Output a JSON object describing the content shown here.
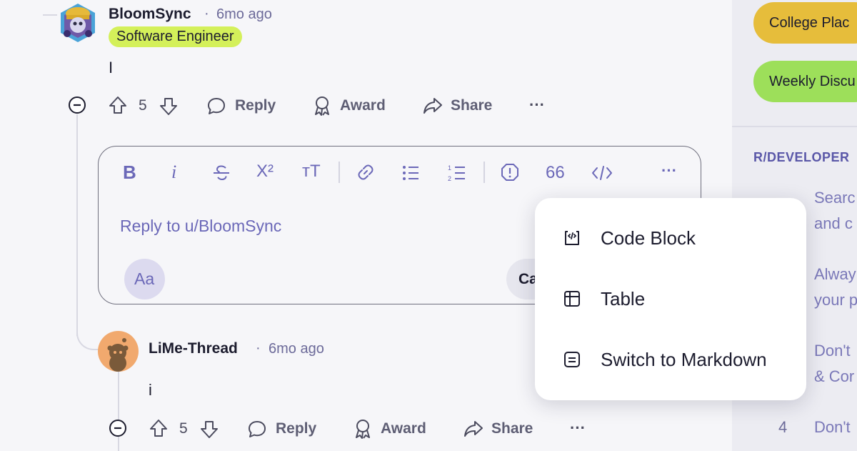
{
  "comment1": {
    "username": "BloomSync",
    "time": "6mo ago",
    "flair": "Software Engineer",
    "body": "I",
    "votes": "5",
    "actions": {
      "reply": "Reply",
      "award": "Award",
      "share": "Share",
      "more": "···"
    }
  },
  "editor": {
    "toolbar": {
      "bold": "B",
      "italic": "i",
      "superscript": "X²",
      "heading": "тT",
      "quote": "66",
      "more": "···"
    },
    "placeholder": "Reply to u/BloomSync",
    "format_button": "Aa",
    "cancel_partial": "Ca"
  },
  "dropdown": {
    "items": [
      {
        "label": "Code Block",
        "icon": "code-block-icon"
      },
      {
        "label": "Table",
        "icon": "table-icon"
      },
      {
        "label": "Switch to Markdown",
        "icon": "markdown-icon"
      }
    ]
  },
  "comment2": {
    "username": "LiMe-Thread",
    "time": "6mo ago",
    "body": "i",
    "votes": "5",
    "actions": {
      "reply": "Reply",
      "award": "Award",
      "share": "Share",
      "more": "···"
    }
  },
  "sidebar": {
    "pills": [
      {
        "label": "College Plac",
        "color": "#e6bd3b"
      },
      {
        "label": "Weekly Discu",
        "color": "#9ddf5a"
      }
    ],
    "section_title": "R/DEVELOPER",
    "rules": [
      {
        "num": "",
        "line1": "Searc",
        "line2": "and c"
      },
      {
        "num": "",
        "line1": "Alway",
        "line2": "your p"
      },
      {
        "num": "",
        "line1": "Don't",
        "line2": "& Cor"
      },
      {
        "num": "4",
        "line1": "Don't",
        "line2": ""
      }
    ]
  },
  "colors": {
    "accent": "#6b68b8",
    "flair": "#d4f05a",
    "meta": "#6c6a99"
  }
}
